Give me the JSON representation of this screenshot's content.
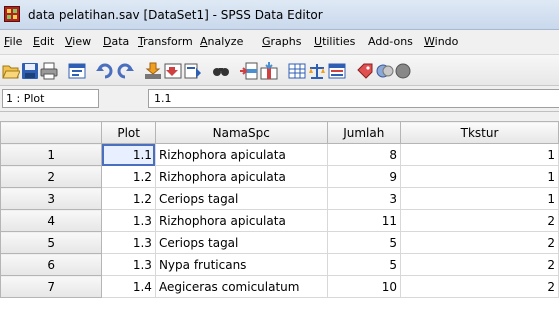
{
  "window": {
    "title": "data pelatihan.sav [DataSet1] - SPSS Data Editor"
  },
  "menu": [
    {
      "label": "File",
      "underline": "F",
      "rest": "ile"
    },
    {
      "label": "Edit",
      "underline": "E",
      "rest": "dit"
    },
    {
      "label": "View",
      "underline": "V",
      "rest": "iew"
    },
    {
      "label": "Data",
      "underline": "D",
      "rest": "ata"
    },
    {
      "label": "Transform",
      "underline": "T",
      "rest": "ransform"
    },
    {
      "label": "Analyze",
      "underline": "A",
      "rest": "nalyze"
    },
    {
      "label": "Graphs",
      "underline": "G",
      "rest": "raphs"
    },
    {
      "label": "Utilities",
      "underline": "U",
      "rest": "tilities"
    },
    {
      "label": "Add-ons",
      "underline": "",
      "rest": "Add-ons"
    },
    {
      "label": "Windo",
      "underline": "W",
      "rest": "indo"
    }
  ],
  "toolbar_icons": [
    "open-folder-icon",
    "save-icon",
    "print-icon",
    "dialog-recall-icon",
    "undo-icon",
    "redo-icon",
    "goto-case-icon",
    "goto-variable-icon",
    "variables-info-icon",
    "find-icon",
    "insert-cases-icon",
    "insert-variable-icon",
    "split-file-icon",
    "weight-cases-icon",
    "select-cases-icon",
    "value-labels-icon",
    "use-sets-icon",
    "show-all-icon"
  ],
  "cell_editor": {
    "ref": "1 : Plot",
    "value": "1.1"
  },
  "table": {
    "columns": [
      "Plot",
      "NamaSpc",
      "Jumlah",
      "Tkstur"
    ],
    "rows": [
      {
        "row": "1",
        "Plot": "1.1",
        "NamaSpc": "Rizhophora apiculata",
        "Jumlah": "8",
        "Tkstur": "1"
      },
      {
        "row": "2",
        "Plot": "1.2",
        "NamaSpc": "Rizhophora apiculata",
        "Jumlah": "9",
        "Tkstur": "1"
      },
      {
        "row": "3",
        "Plot": "1.2",
        "NamaSpc": "Ceriops tagal",
        "Jumlah": "3",
        "Tkstur": "1"
      },
      {
        "row": "4",
        "Plot": "1.3",
        "NamaSpc": "Rizhophora apiculata",
        "Jumlah": "11",
        "Tkstur": "2"
      },
      {
        "row": "5",
        "Plot": "1.3",
        "NamaSpc": "Ceriops tagal",
        "Jumlah": "5",
        "Tkstur": "2"
      },
      {
        "row": "6",
        "Plot": "1.3",
        "NamaSpc": "Nypa fruticans",
        "Jumlah": "5",
        "Tkstur": "2"
      },
      {
        "row": "7",
        "Plot": "1.4",
        "NamaSpc": "Aegiceras comiculatum",
        "Jumlah": "10",
        "Tkstur": "2"
      }
    ]
  },
  "colors": {
    "selection": "#4a6fbf",
    "title_bar": "#c9d8ec"
  }
}
